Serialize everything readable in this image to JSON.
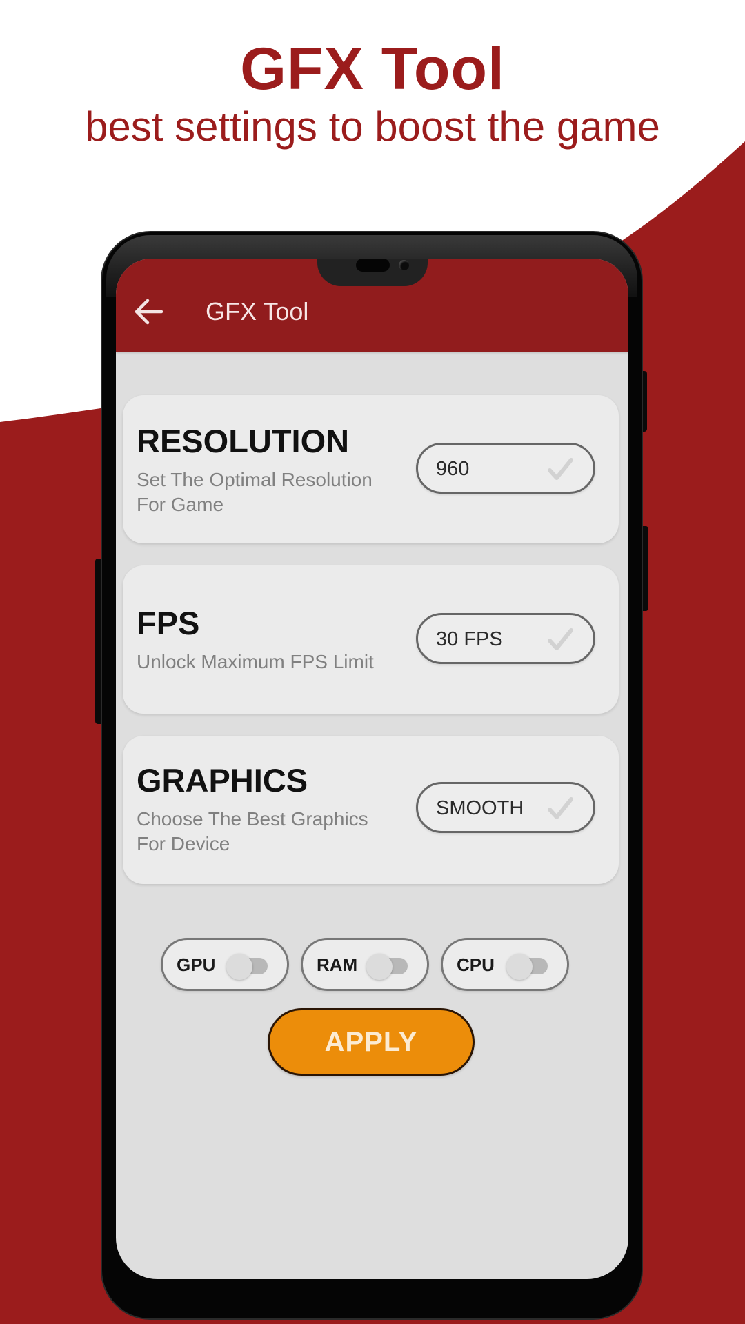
{
  "promo": {
    "title": "GFX Tool",
    "subtitle": "best settings to boost the game"
  },
  "app_bar": {
    "back_icon": "arrow-left-icon",
    "title": "GFX Tool"
  },
  "settings": [
    {
      "title": "RESOLUTION",
      "description": "Set The Optimal Resolution For Game",
      "value": "960",
      "confirm_icon": "checkmark-icon"
    },
    {
      "title": "FPS",
      "description": "Unlock Maximum FPS Limit",
      "value": "30 FPS",
      "confirm_icon": "checkmark-icon"
    },
    {
      "title": "GRAPHICS",
      "description": "Choose The Best Graphics For Device",
      "value": "SMOOTH",
      "confirm_icon": "checkmark-icon"
    }
  ],
  "toggles": [
    {
      "label": "GPU",
      "on": false
    },
    {
      "label": "RAM",
      "on": false
    },
    {
      "label": "CPU",
      "on": false
    }
  ],
  "apply_button": {
    "label": "APPLY"
  },
  "colors": {
    "brand_red": "#911c1d",
    "promo_red": "#9b1c1c",
    "apply_orange": "#ec8d0a",
    "screen_bg": "#dedede",
    "card_bg": "#ebebeb"
  }
}
